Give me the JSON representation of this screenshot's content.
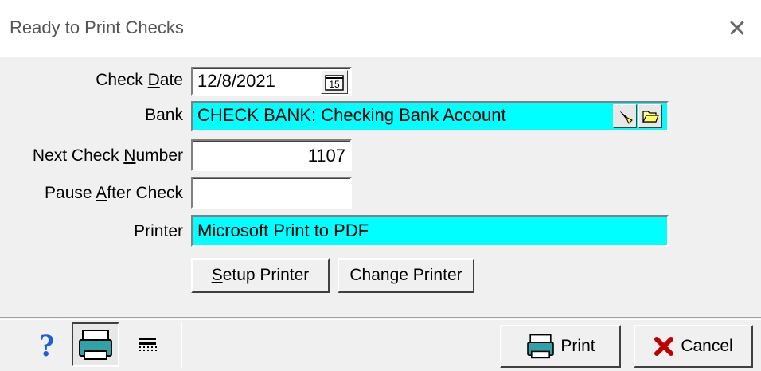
{
  "window": {
    "title": "Ready to Print Checks",
    "close_glyph": "✕"
  },
  "form": {
    "check_date": {
      "label_pre": "Check ",
      "label_ul": "D",
      "label_post": "ate",
      "value": "12/8/2021",
      "calendar_label": "15"
    },
    "bank": {
      "label": "Bank",
      "value": "CHECK BANK: Checking Bank Account"
    },
    "next_check_number": {
      "label_pre": "Next Check ",
      "label_ul": "N",
      "label_post": "umber",
      "value": "1107"
    },
    "pause_after_check": {
      "label_pre": "Pause ",
      "label_ul": "A",
      "label_post": "fter Check",
      "value": ""
    },
    "printer": {
      "label": "Printer",
      "value": "Microsoft Print to PDF"
    }
  },
  "buttons": {
    "setup_printer_ul": "S",
    "setup_printer_rest": "etup Printer",
    "change_printer": "Change Printer",
    "print": "Print",
    "cancel": "Cancel"
  },
  "toolbar": {
    "help_glyph": "?"
  },
  "colors": {
    "highlight_field": "#00ffff",
    "help_icon": "#1e5fd8",
    "cancel_x": "#c00000"
  }
}
